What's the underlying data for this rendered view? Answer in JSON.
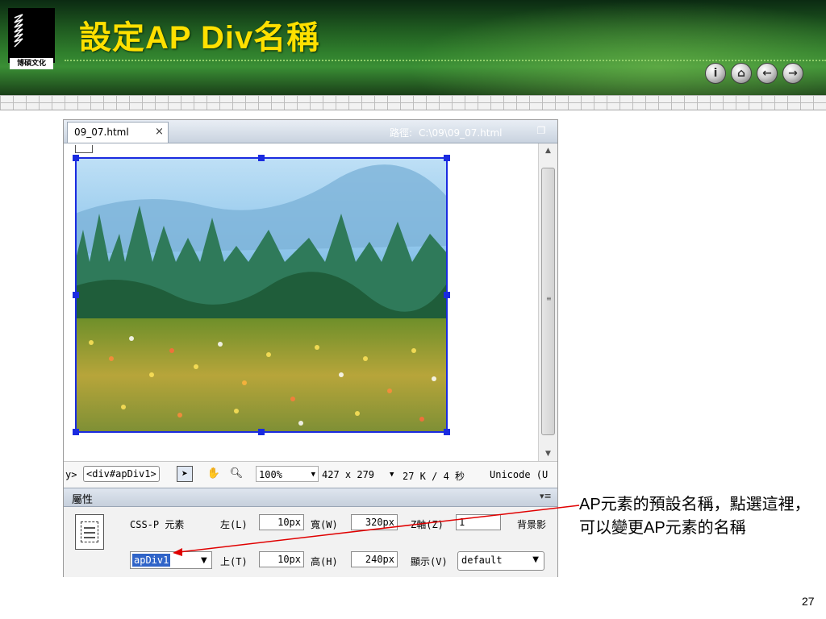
{
  "slide": {
    "title": "設定AP Div名稱",
    "logo_text": "博碩文化",
    "page_number": "27",
    "nav_buttons": [
      {
        "icon": "info-icon"
      },
      {
        "icon": "home-icon"
      },
      {
        "icon": "arrow-left-icon"
      },
      {
        "icon": "arrow-right-icon"
      }
    ]
  },
  "editor": {
    "tab_label": "09_07.html",
    "tab_close": "×",
    "path_label": "路徑:",
    "path_value": "C:\\09\\09_07.html",
    "status": {
      "crumb_prefix": "y>",
      "crumb": "<div#apDiv1>",
      "zoom": "100%",
      "dimensions": "427 x 279",
      "size_time": "27 K / 4 秒",
      "encoding": "Unicode (U"
    }
  },
  "properties": {
    "title": "屬性",
    "element_type": "CSS-P 元素",
    "name_value": "apDiv1",
    "left_label": "左(L)",
    "left_value": "10px",
    "top_label": "上(T)",
    "top_value": "10px",
    "width_label": "寬(W)",
    "width_value": "320px",
    "height_label": "高(H)",
    "height_value": "240px",
    "zindex_label": "Z軸(Z)",
    "zindex_value": "1",
    "visibility_label": "顯示(V)",
    "visibility_value": "default",
    "bg_label": "背景影"
  },
  "callout": {
    "text": "AP元素的預設名稱，點選這裡，可以變更AP元素的名稱"
  },
  "colors": {
    "header_green": "#2f7e2c",
    "title_yellow": "#ffe000",
    "apdiv_border": "#1a2be0",
    "callout_arrow": "#e00000",
    "selection": "#3064c8"
  }
}
